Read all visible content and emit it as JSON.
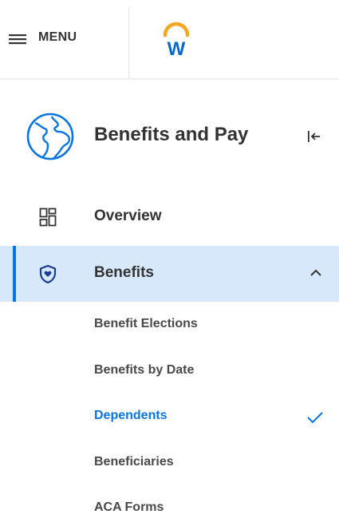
{
  "header": {
    "menu_label": "MENU",
    "logo_letter": "W"
  },
  "section": {
    "title": "Benefits and Pay"
  },
  "nav": {
    "items": [
      {
        "label": "Overview",
        "icon": "dashboard-grid-icon"
      },
      {
        "label": "Benefits",
        "icon": "shield-heart-icon",
        "expanded": true,
        "selected": true
      }
    ],
    "sub_items": [
      {
        "label": "Benefit Elections",
        "active": false
      },
      {
        "label": "Benefits by Date",
        "active": false
      },
      {
        "label": "Dependents",
        "active": true
      },
      {
        "label": "Beneficiaries",
        "active": false
      },
      {
        "label": "ACA Forms",
        "active": false
      }
    ]
  },
  "colors": {
    "accent_blue": "#0875e1",
    "selected_bg": "#d7e8fb",
    "logo_orange": "#f5a623",
    "logo_blue": "#0a68c8"
  }
}
